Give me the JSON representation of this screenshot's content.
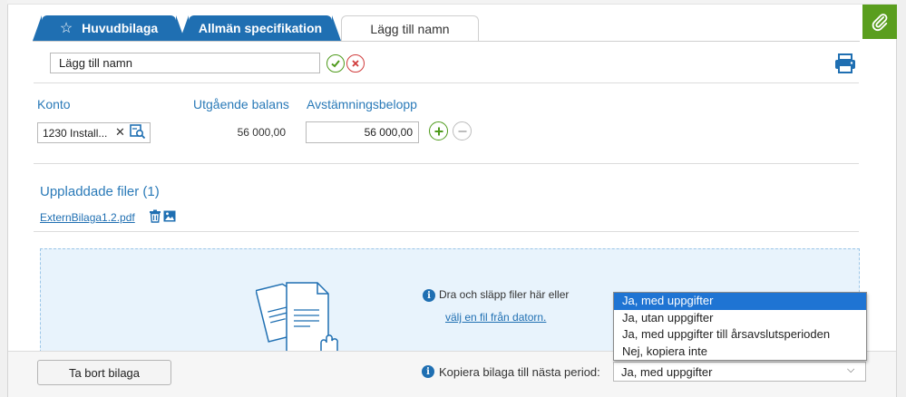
{
  "tabs": [
    {
      "label": "Huvudbilaga",
      "icon": "star-icon"
    },
    {
      "label": "Allmän specifikation"
    },
    {
      "label": "Lägg till namn",
      "active": true
    }
  ],
  "name_field": {
    "value": "Lägg till namn"
  },
  "columns": {
    "konto": "Konto",
    "balance": "Utgående balans",
    "reconcile": "Avstämningsbelopp"
  },
  "row": {
    "konto_value": "1230 Install...",
    "balance_value": "56 000,00",
    "amount_value": "56 000,00"
  },
  "uploaded": {
    "title": "Uppladdade filer (1)",
    "files": [
      {
        "name": "ExternBilaga1.2.pdf"
      }
    ]
  },
  "dropzone": {
    "text": "Dra och släpp filer här eller",
    "link": "välj en fil från datorn."
  },
  "footer": {
    "remove_button": "Ta bort bilaga",
    "copy_label": "Kopiera bilaga till nästa period:",
    "copy_selected": "Ja, med uppgifter"
  },
  "dropdown": {
    "options": [
      "Ja, med uppgifter",
      "Ja, utan uppgifter",
      "Ja, med uppgifter till årsavslutsperioden",
      "Nej, kopiera inte"
    ],
    "selected_index": 0
  },
  "colors": {
    "tab_blue": "#1f6fb2",
    "accent_green": "#5a9e1e",
    "link_blue": "#2a7ab8",
    "cancel_red": "#d03b3b"
  }
}
